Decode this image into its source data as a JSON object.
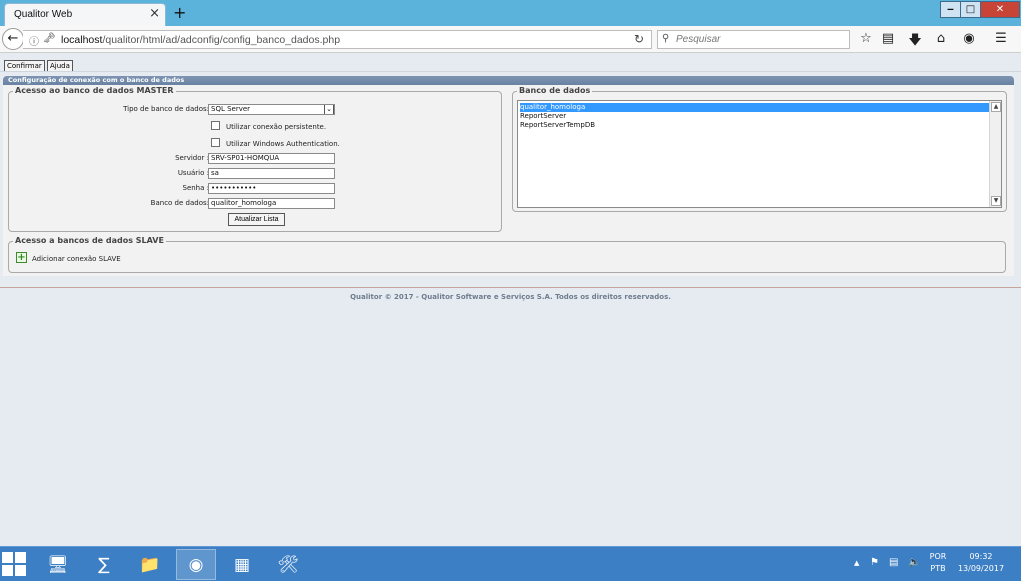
{
  "browser": {
    "tab_title": "Qualitor Web",
    "tab_close": "×",
    "new_tab": "+",
    "url_host": "localhost",
    "url_path": "/qualitor/html/ad/adconfig/config_banco_dados.php",
    "search_placeholder": "Pesquisar",
    "win_min": "‒",
    "win_max": "□",
    "win_close": "✕"
  },
  "toolbar": {
    "confirm_label": "Confirmar",
    "help_label": "Ajuda"
  },
  "panel": {
    "header": "Configuração de conexão com o banco de dados"
  },
  "master": {
    "legend": "Acesso ao banco de dados MASTER",
    "db_type_label": "Tipo de banco de dados:",
    "db_type_value": "SQL Server",
    "persistent_label": "Utilizar conexão persistente.",
    "persistent_checked": false,
    "windows_auth_label": "Utilizar Windows Authentication.",
    "windows_auth_checked": false,
    "server_label": "Servidor :",
    "server_value": "SRV-SP01-HOMQUA",
    "user_label": "Usuário :",
    "user_value": "sa",
    "password_label": "Senha :",
    "password_value": "•••••••••••",
    "database_label": "Banco de dados:",
    "database_value": "qualitor_homologa",
    "update_button": "Atualizar Lista"
  },
  "databases": {
    "legend": "Banco de dados",
    "items": [
      "qualitor_homologa",
      "ReportServer",
      "ReportServerTempDB"
    ],
    "selected": "qualitor_homologa"
  },
  "slave": {
    "legend": "Acesso a bancos de dados SLAVE",
    "add_label": "Adicionar conexão SLAVE"
  },
  "footer": {
    "text": "Qualitor © 2017 - Qualitor Software e Serviços S.A. Todos os direitos reservados."
  },
  "taskbar": {
    "language_top": "POR",
    "language_bottom": "PTB",
    "time": "09:32",
    "date": "13/09/2017"
  }
}
